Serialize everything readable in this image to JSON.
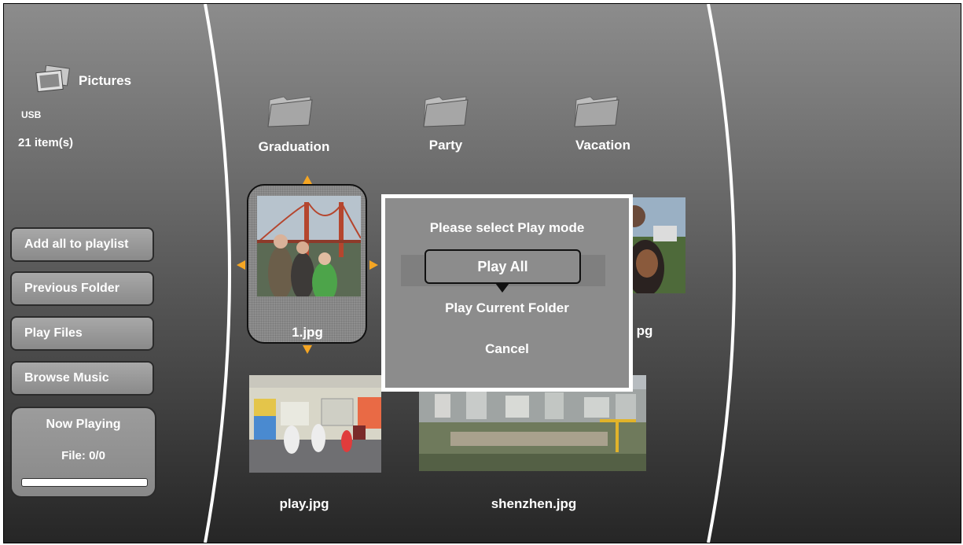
{
  "sidebar": {
    "title": "Pictures",
    "source": "USB",
    "item_count": "21 item(s)",
    "buttons": [
      "Add all to playlist",
      "Previous Folder",
      "Play Files",
      "Browse Music"
    ],
    "now_playing": {
      "title": "Now Playing",
      "file": "File: 0/0",
      "progress": 0
    }
  },
  "grid": {
    "folders": [
      "Graduation",
      "Party",
      "Vacation"
    ],
    "files": [
      "1.jpg",
      "pg",
      "play.jpg",
      "shenzhen.jpg"
    ]
  },
  "dialog": {
    "title": "Please select Play mode",
    "options": [
      "Play All",
      "Play Current Folder",
      "Cancel"
    ]
  },
  "colors": {
    "arrow": "#f5a623",
    "panel": "#8c8c8c"
  }
}
